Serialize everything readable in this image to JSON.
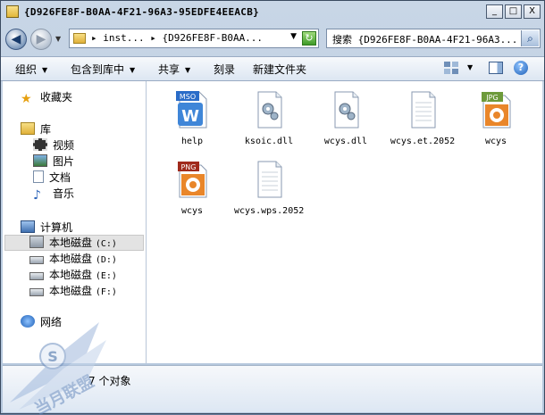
{
  "window": {
    "title": "{D926FE8F-B0AA-4F21-96A3-95EDFE4EEACB}",
    "controls": {
      "minimize": "_",
      "maximize": "□",
      "close": "X"
    }
  },
  "nav": {
    "back_glyph": "◀",
    "forward_glyph": "▶",
    "address_text": "▸ inst... ▸ {D926FE8F-B0AA...",
    "search_text": "搜索 {D926FE8F-B0AA-4F21-96A3...",
    "search_icon": "magnifier-icon",
    "refresh_icon": "refresh-icon"
  },
  "toolbar": {
    "organize": "组织",
    "include_in_library": "包含到库中",
    "share": "共享",
    "burn": "刻录",
    "new_folder": "新建文件夹",
    "help": "?"
  },
  "sidebar": {
    "favorites": "收藏夹",
    "libraries": "库",
    "video": "视频",
    "pictures": "图片",
    "documents": "文档",
    "music": "音乐",
    "computer": "计算机",
    "drives": [
      {
        "name": "本地磁盘",
        "letter": "(C:)"
      },
      {
        "name": "本地磁盘",
        "letter": "(D:)"
      },
      {
        "name": "本地磁盘",
        "letter": "(E:)"
      },
      {
        "name": "本地磁盘",
        "letter": "(F:)"
      }
    ],
    "network": "网络"
  },
  "files": [
    {
      "name": "help",
      "icon": "msoffice-help-icon",
      "badge": "MSO"
    },
    {
      "name": "ksoic.dll",
      "icon": "dll-gear-icon"
    },
    {
      "name": "wcys.dll",
      "icon": "dll-gear-icon"
    },
    {
      "name": "wcys.et.2052",
      "icon": "blank-file-icon"
    },
    {
      "name": "wcys",
      "icon": "jpg-image-icon",
      "badge": "JPG"
    },
    {
      "name": "wcys",
      "icon": "png-image-icon",
      "badge": "PNG"
    },
    {
      "name": "wcys.wps.2052",
      "icon": "blank-file-icon"
    }
  ],
  "status": {
    "text": "7 个对象"
  },
  "watermark": {
    "text": "当月联盟"
  },
  "colors": {
    "accent_orange": "#e9862a",
    "jpg_green": "#6d9a3a",
    "png_red": "#a02a1c",
    "selection_gray": "#e3e3e3"
  }
}
